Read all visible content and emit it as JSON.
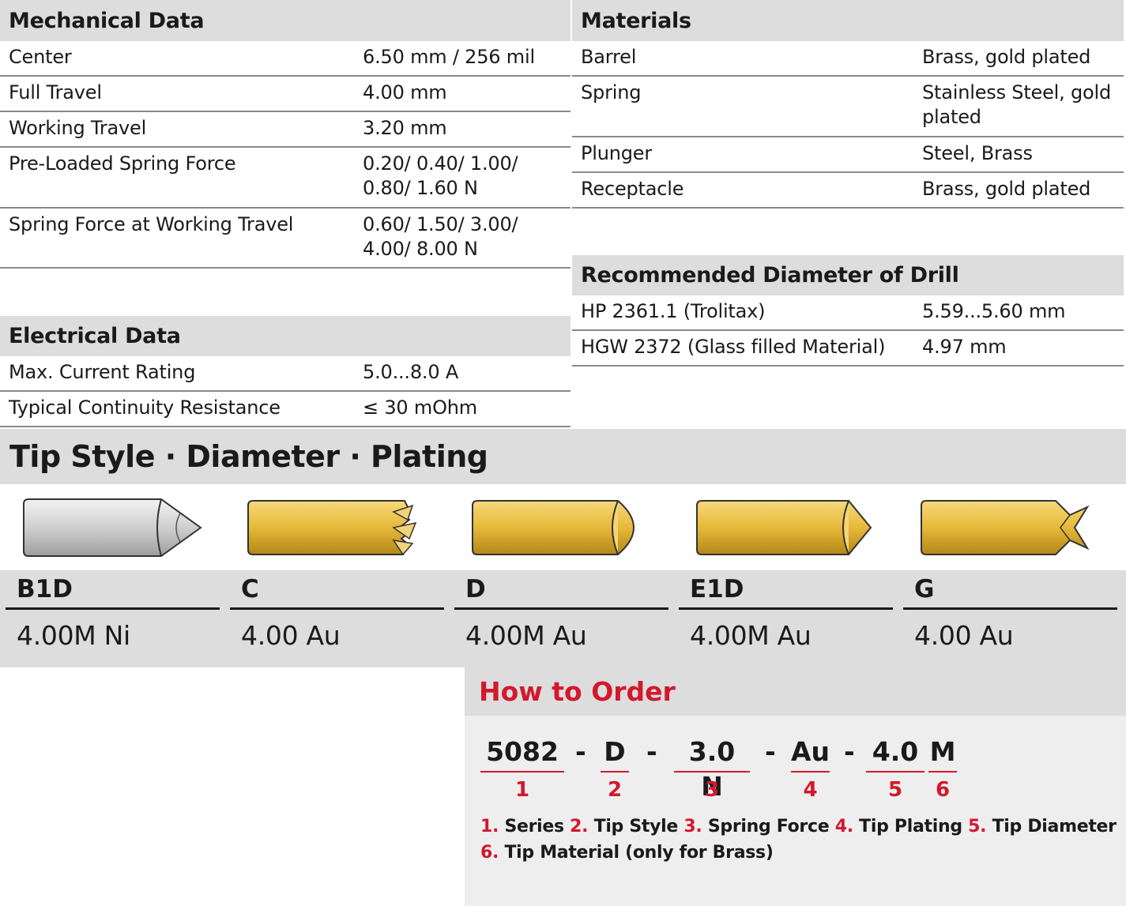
{
  "mechanical": {
    "title": "Mechanical Data",
    "rows": [
      {
        "label": "Center",
        "value": "6.50 mm / 256 mil"
      },
      {
        "label": "Full Travel",
        "value": "4.00 mm"
      },
      {
        "label": "Working Travel",
        "value": "3.20 mm"
      },
      {
        "label": "Pre-Loaded Spring Force",
        "value": "0.20/ 0.40/ 1.00/ 0.80/ 1.60 N"
      },
      {
        "label": "Spring Force at Working Travel",
        "value": "0.60/ 1.50/ 3.00/ 4.00/ 8.00 N"
      }
    ]
  },
  "electrical": {
    "title": "Electrical Data",
    "rows": [
      {
        "label": "Max. Current Rating",
        "value": "5.0...8.0 A"
      },
      {
        "label": "Typical Continuity Resistance",
        "value": "≤ 30 mOhm"
      }
    ]
  },
  "materials": {
    "title": "Materials",
    "rows": [
      {
        "label": "Barrel",
        "value": "Brass, gold plated"
      },
      {
        "label": "Spring",
        "value": "Stainless Steel, gold plated"
      },
      {
        "label": "Plunger",
        "value": "Steel, Brass"
      },
      {
        "label": "Receptacle",
        "value": "Brass, gold plated"
      }
    ]
  },
  "drill": {
    "title": "Recommended Diameter of Drill",
    "rows": [
      {
        "label": "HP 2361.1 (Trolitax)",
        "value": "5.59...5.60 mm"
      },
      {
        "label": "HGW 2372 (Glass filled Material)",
        "value": "4.97 mm"
      }
    ]
  },
  "tips": {
    "title": "Tip Style · Diameter · Plating",
    "items": [
      {
        "code": "B1D",
        "spec": "4.00M Ni",
        "shape": "pointed-tip-icon",
        "color": "#d6d6d6"
      },
      {
        "code": "C",
        "spec": "4.00 Au",
        "shape": "crown-tip-icon",
        "color": "#e9bb3e"
      },
      {
        "code": "D",
        "spec": "4.00M Au",
        "shape": "round-tip-icon",
        "color": "#e9bb3e"
      },
      {
        "code": "E1D",
        "spec": "4.00M Au",
        "shape": "flat-round-tip-icon",
        "color": "#e9bb3e"
      },
      {
        "code": "G",
        "spec": "4.00 Au",
        "shape": "serrated-tip-icon",
        "color": "#e9bb3e"
      }
    ]
  },
  "order": {
    "title": "How to Order",
    "parts": [
      {
        "text": "5082",
        "num": "1"
      },
      {
        "text": "D",
        "num": "2"
      },
      {
        "text": "3.0 N",
        "num": "3"
      },
      {
        "text": "Au",
        "num": "4"
      },
      {
        "text": "4.0",
        "num": "5"
      },
      {
        "text": "M",
        "num": "6"
      }
    ],
    "dash": "-",
    "legend": [
      {
        "n": "1.",
        "t": "Series"
      },
      {
        "n": "2.",
        "t": "Tip Style"
      },
      {
        "n": "3.",
        "t": "Spring Force"
      },
      {
        "n": "4.",
        "t": "Tip Plating"
      },
      {
        "n": "5.",
        "t": "Tip Diameter"
      },
      {
        "n": "6.",
        "t": "Tip Material (only for Brass)"
      }
    ]
  },
  "colors": {
    "accent": "#d3182d",
    "header_bg": "#dddddd",
    "gold": "#e9bb3e"
  }
}
